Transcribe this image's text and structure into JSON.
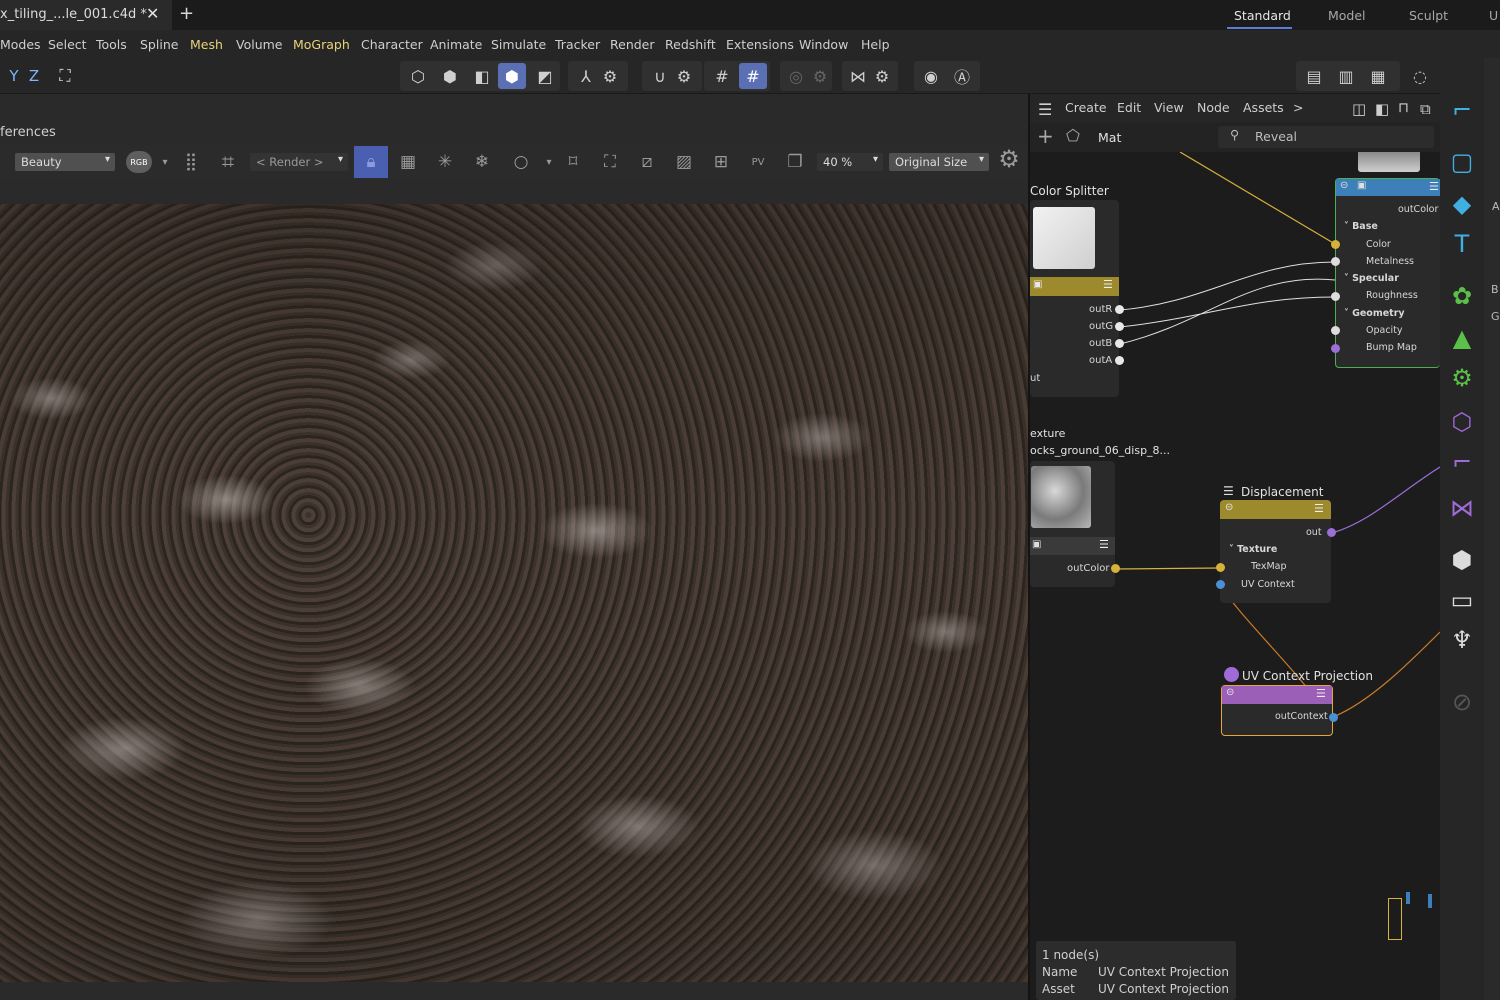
{
  "window": {
    "tab_title": "x_tiling_...le_001.c4d *",
    "close_glyph": "✕",
    "new_tab_glyph": "+"
  },
  "layouts": [
    "Standard",
    "Model",
    "Sculpt",
    "U"
  ],
  "menu": [
    "Modes",
    "Select",
    "Tools",
    "Spline",
    "Mesh",
    "Volume",
    "MoGraph",
    "Character",
    "Animate",
    "Simulate",
    "Tracker",
    "Render",
    "Redshift",
    "Extensions",
    "Window",
    "Help"
  ],
  "axis_labels": [
    "Y",
    "Z"
  ],
  "viewport": {
    "title": "ferences",
    "aov_select": "Beauty",
    "rgb_badge": "RGB",
    "render_select": "< Render >",
    "pv_badge": "PV",
    "zoom_value": "40 %",
    "size_select": "Original Size"
  },
  "node_editor": {
    "menu": [
      "Create",
      "Edit",
      "View",
      "Node",
      "Assets"
    ],
    "more_glyph": ">",
    "material_name": "Mat",
    "search_placeholder": "Reveal",
    "color_splitter": {
      "title": "Color Splitter",
      "ports": [
        "outR",
        "outG",
        "outB",
        "outA"
      ],
      "input": "ut"
    },
    "texture": {
      "title": "exture",
      "file": "ocks_ground_06_disp_8...",
      "output": "outColor"
    },
    "material_output": {
      "output": "outColor",
      "groups": [
        {
          "name": "Base",
          "items": [
            "Color",
            "Metalness"
          ]
        },
        {
          "name": "Specular",
          "items": [
            "Roughness"
          ]
        },
        {
          "name": "Geometry",
          "items": [
            "Opacity",
            "Bump Map"
          ]
        }
      ]
    },
    "displacement": {
      "title": "Displacement",
      "output": "out",
      "group": "Texture",
      "items": [
        "TexMap",
        "UV Context"
      ]
    },
    "uv_context": {
      "title": "UV Context Projection",
      "output": "outContext"
    },
    "info": {
      "count": "1 node(s)",
      "name_label": "Name",
      "name_value": "UV Context Projection",
      "asset_label": "Asset",
      "asset_value": "UV Context Projection"
    }
  },
  "edge_letters": [
    "A",
    "B",
    "G"
  ],
  "colors": {
    "accent": "#5b6fb5",
    "yellow_wire": "#d6b23a",
    "purple_wire": "#9b6fd6",
    "orange_wire": "#c97a2a",
    "green_node": "#4caf50",
    "blue_node_head": "#3d7fb8",
    "palette_cyan": "#3fb0e0",
    "palette_green": "#5ac04a",
    "palette_purple": "#a06ad8"
  }
}
